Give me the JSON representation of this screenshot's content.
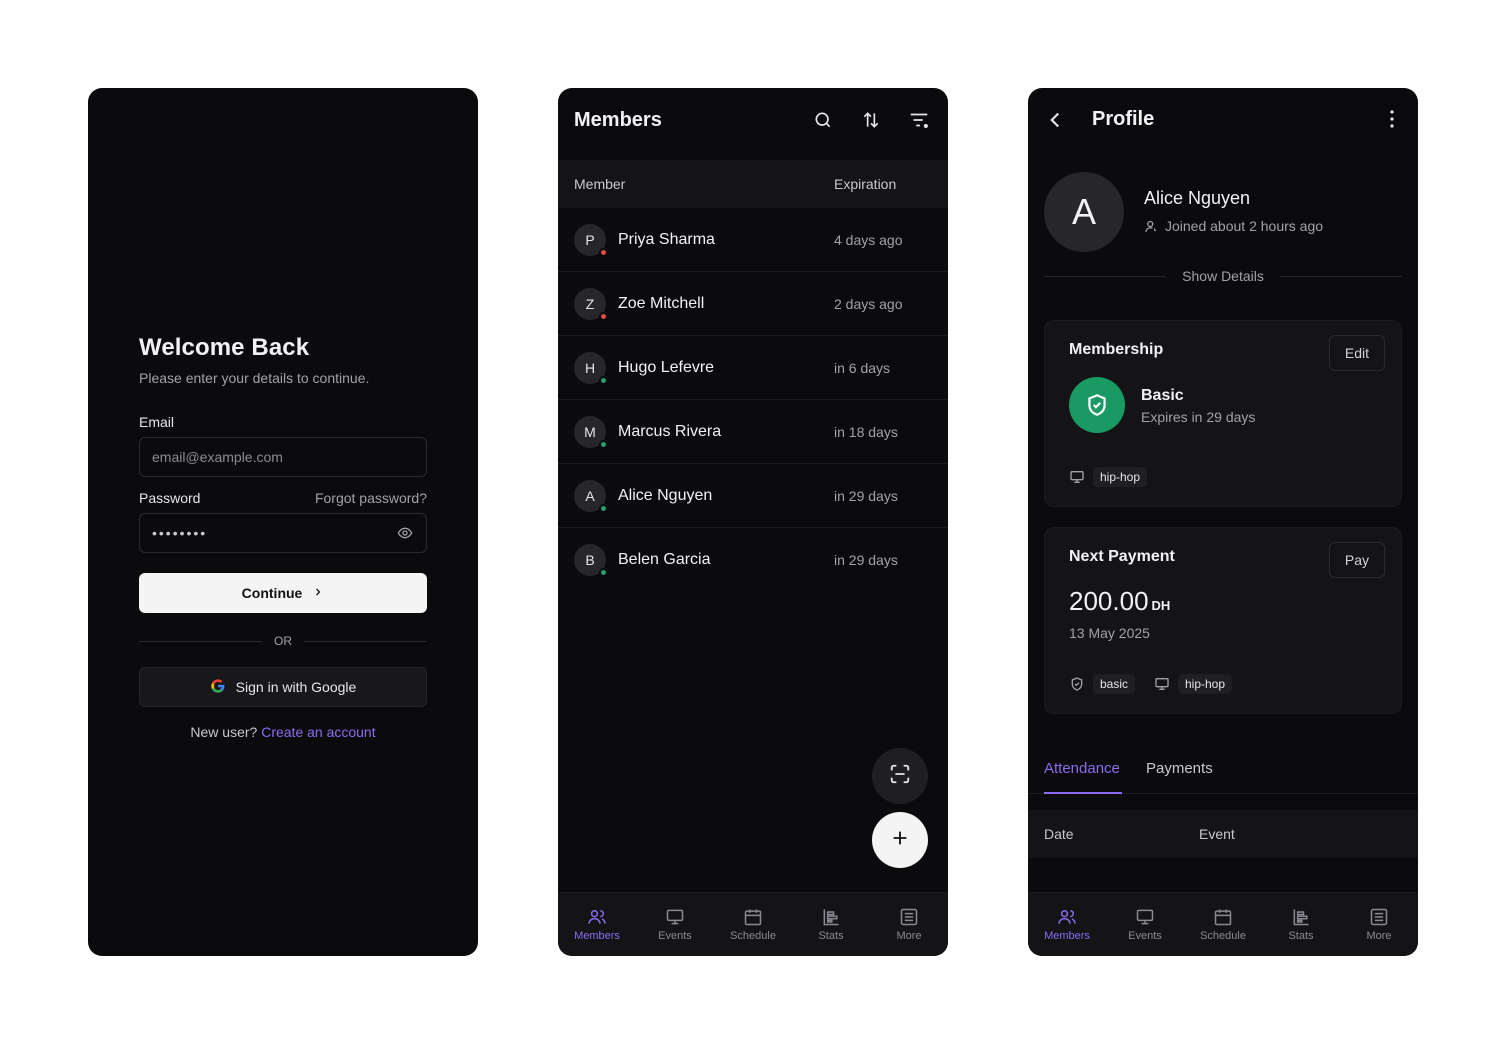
{
  "login": {
    "title": "Welcome Back",
    "subtitle": "Please enter your details to continue.",
    "email_label": "Email",
    "email_placeholder": "email@example.com",
    "password_label": "Password",
    "forgot_password": "Forgot password?",
    "password_mask": "••••••••",
    "continue_label": "Continue",
    "or_label": "OR",
    "google_label": "Sign in with Google",
    "new_user_text": "New user?",
    "create_account": "Create an account"
  },
  "members": {
    "title": "Members",
    "col_member": "Member",
    "col_expiration": "Expiration",
    "rows": [
      {
        "initial": "P",
        "name": "Priya Sharma",
        "expiration": "4 days ago",
        "status": "expired"
      },
      {
        "initial": "Z",
        "name": "Zoe Mitchell",
        "expiration": "2 days ago",
        "status": "expired"
      },
      {
        "initial": "H",
        "name": "Hugo Lefevre",
        "expiration": "in 6 days",
        "status": "active"
      },
      {
        "initial": "M",
        "name": "Marcus Rivera",
        "expiration": "in 18 days",
        "status": "active"
      },
      {
        "initial": "A",
        "name": "Alice Nguyen",
        "expiration": "in 29 days",
        "status": "active"
      },
      {
        "initial": "B",
        "name": "Belen Garcia",
        "expiration": "in 29 days",
        "status": "active"
      }
    ]
  },
  "profile": {
    "title": "Profile",
    "avatar_initial": "A",
    "name": "Alice Nguyen",
    "joined": "Joined about 2 hours ago",
    "show_details": "Show Details",
    "membership": {
      "title": "Membership",
      "edit_label": "Edit",
      "plan": "Basic",
      "expires": "Expires in 29 days",
      "tag": "hip-hop"
    },
    "payment": {
      "title": "Next Payment",
      "pay_label": "Pay",
      "amount": "200.00",
      "currency": "DH",
      "date": "13 May 2025",
      "tag_plan": "basic",
      "tag_event": "hip-hop"
    },
    "tabs": [
      "Attendance",
      "Payments"
    ],
    "table_cols": [
      "Date",
      "Event"
    ]
  },
  "nav": {
    "members": "Members",
    "events": "Events",
    "schedule": "Schedule",
    "stats": "Stats",
    "more": "More"
  },
  "colors": {
    "accent": "#8b6cf0",
    "status_active": "#22a06b",
    "status_expired": "#e5484d",
    "plan_green": "#1a9a63",
    "background": "#0b0b0d"
  }
}
